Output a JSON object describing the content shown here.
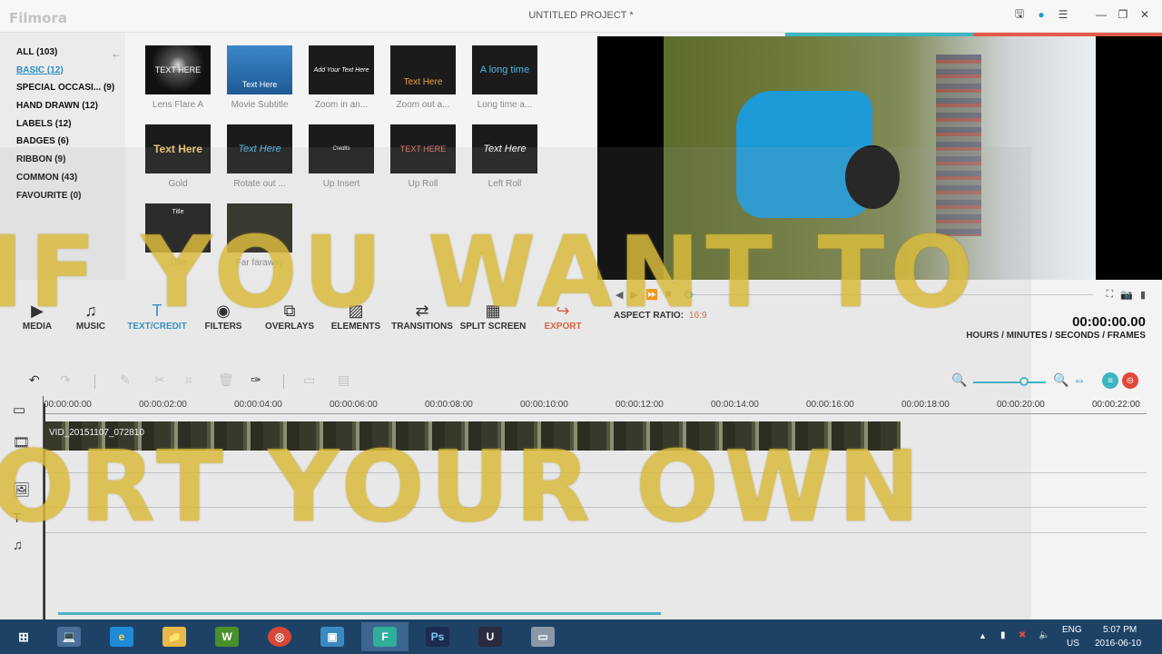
{
  "app": {
    "logo": "Filmora",
    "project_title": "UNTITLED PROJECT *"
  },
  "categories": [
    {
      "label": "ALL (103)"
    },
    {
      "label": "BASIC (12)"
    },
    {
      "label": "SPECIAL OCCASI...  (9)"
    },
    {
      "label": "HAND DRAWN (12)"
    },
    {
      "label": "LABELS (12)"
    },
    {
      "label": "BADGES (6)"
    },
    {
      "label": "RIBBON (9)"
    },
    {
      "label": "COMMON (43)"
    },
    {
      "label": "FAVOURITE (0)"
    }
  ],
  "thumbnails": [
    {
      "caption": "Lens Flare A",
      "text": "TEXT HERE"
    },
    {
      "caption": "Movie Subtitle",
      "text": "Text Here"
    },
    {
      "caption": "Zoom in an...",
      "text": "Add Your Text Here"
    },
    {
      "caption": "Zoom out a...",
      "text": "Text Here"
    },
    {
      "caption": "Long time a...",
      "text": "A long time"
    },
    {
      "caption": "Gold",
      "text": "Text Here"
    },
    {
      "caption": "Rotate out ...",
      "text": "Text Here"
    },
    {
      "caption": "Up Insert",
      "text": "Credits"
    },
    {
      "caption": "Up Roll",
      "text": "TEXT HERE"
    },
    {
      "caption": "Left Roll",
      "text": "Text Here"
    },
    {
      "caption": "Title",
      "text": "Title"
    },
    {
      "caption": "Far faraway",
      "text": ""
    }
  ],
  "tools": [
    {
      "label": "MEDIA",
      "icon": "▶"
    },
    {
      "label": "MUSIC",
      "icon": "♫"
    },
    {
      "label": "TEXT/CREDIT",
      "icon": "T"
    },
    {
      "label": "FILTERS",
      "icon": "◉"
    },
    {
      "label": "OVERLAYS",
      "icon": "⧉"
    },
    {
      "label": "ELEMENTS",
      "icon": "▨"
    },
    {
      "label": "TRANSITIONS",
      "icon": "⇄"
    },
    {
      "label": "SPLIT SCREEN",
      "icon": "▦"
    },
    {
      "label": "EXPORT",
      "icon": "↪"
    }
  ],
  "player": {
    "aspect_label": "ASPECT RATIO:",
    "aspect_value": "16:9",
    "timecode": "00:00:00.00",
    "units": "HOURS / MINUTES / SECONDS / FRAMES"
  },
  "ruler": [
    "00:00:00:00",
    "00:00:02:00",
    "00:00:04:00",
    "00:00:06:00",
    "00:00:08:00",
    "00:00:10:00",
    "00:00:12:00",
    "00:00:14:00",
    "00:00:16:00",
    "00:00:18:00",
    "00:00:20:00",
    "00:00:22:00"
  ],
  "clip": {
    "label": "VID_20151107_072810"
  },
  "overlay": {
    "line1": "IF YOU WANT TO",
    "line2": "ORT YOUR OWN"
  },
  "taskbar": {
    "apps": [
      "⊞",
      "💻",
      "e",
      "📁",
      "W",
      "◎",
      "▣",
      "F",
      "Ps",
      "U",
      "▭"
    ],
    "lang": "ENG",
    "region": "US",
    "time": "5:07 PM",
    "date": "2016-06-10"
  }
}
